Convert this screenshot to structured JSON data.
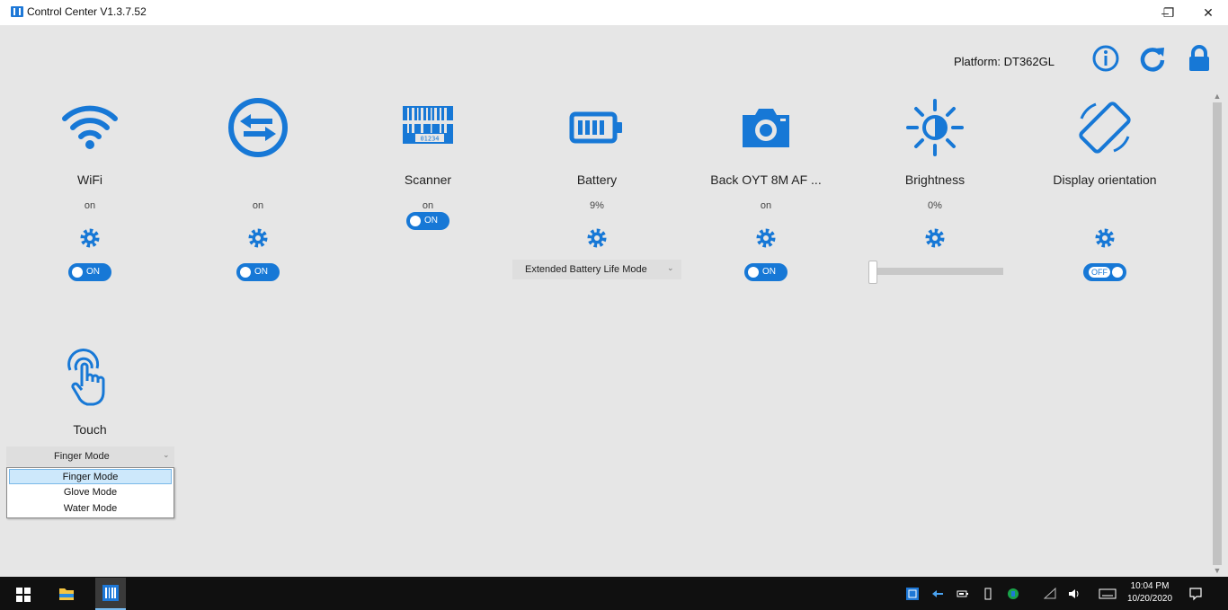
{
  "window": {
    "title": "Control Center V1.3.7.52",
    "minimize": "–",
    "restore": "❐",
    "close": "✕"
  },
  "header": {
    "platform_label": "Platform: DT362GL",
    "icons": [
      "info-icon",
      "refresh-icon",
      "lock-icon"
    ]
  },
  "tiles": [
    {
      "label": "WiFi",
      "state": "on",
      "control": "toggle",
      "toggle_text": "ON"
    },
    {
      "label": "",
      "state": "on",
      "control": "toggle",
      "toggle_text": "ON"
    },
    {
      "label": "Scanner",
      "state": "on",
      "control": "toggle",
      "toggle_text": "ON"
    },
    {
      "label": "Battery",
      "state": "9%",
      "control": "dropdown",
      "dropdown_value": "Extended Battery Life Mode"
    },
    {
      "label": "Back OYT 8M AF ...",
      "state": "on",
      "control": "toggle",
      "toggle_text": "ON"
    },
    {
      "label": "Brightness",
      "state": "0%",
      "control": "slider",
      "slider_value": 0
    },
    {
      "label": "Display orientation",
      "state": "",
      "control": "toggle",
      "toggle_text": "OFF"
    }
  ],
  "touch": {
    "label": "Touch",
    "selected": "Finger Mode",
    "options": [
      "Finger Mode",
      "Glove Mode",
      "Water Mode"
    ]
  },
  "taskbar": {
    "time": "10:04 PM",
    "date": "10/20/2020"
  },
  "colors": {
    "accent": "#1778d6",
    "background": "#e6e6e6",
    "taskbar": "#101010"
  }
}
